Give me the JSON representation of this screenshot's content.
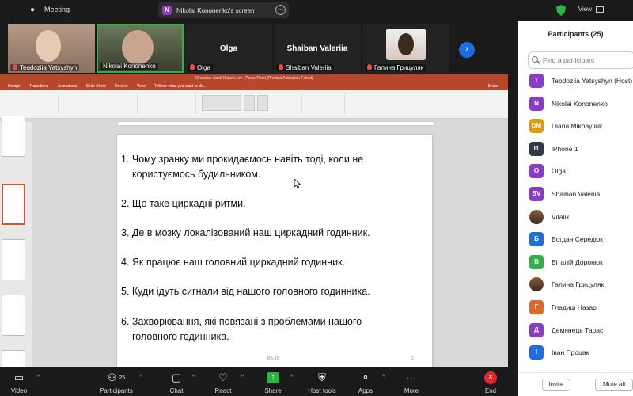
{
  "topbar": {
    "app_title": "Meeting",
    "share_badge": "N",
    "share_label": "Nikolai Kononenko's screen",
    "more": "···",
    "view_label": "View"
  },
  "video_tiles": [
    {
      "name": "Teodoziia Yatsyshyn",
      "muted": true
    },
    {
      "name": "Nikolai Kononenko",
      "muted": false
    },
    {
      "big_name": "Olga",
      "name": "Olga",
      "muted": true
    },
    {
      "big_name": "Shaiban Valeriia",
      "name": "Shaiban Valeriia",
      "muted": true
    },
    {
      "name": "Галина Грицуляк",
      "muted": true
    }
  ],
  "powerpoint": {
    "title": "Circadian clock Report.1cv - PowerPoint (Product Activation Failed)",
    "tabs": [
      "Design",
      "Transitions",
      "Animations",
      "Slide Show",
      "Review",
      "View",
      "Tell me what you want to do..."
    ],
    "share": "Share",
    "slide_lines": [
      "1. Чому зранку ми прокидаємось навіть тоді, коли не",
      "користуємось будильником.",
      "2. Що таке циркадні ритми.",
      "3. Де в мозку локалізований наш циркадний годинник.",
      "4. Як працює наш головний циркадний годинник.",
      "5. Куди ідуть сигнали від нашого головного годинника.",
      "6. Захворювання, які повязані з проблемами нашого",
      "головного годинника."
    ],
    "footer": "ИБ-33",
    "slide_number": "2"
  },
  "toolbar": {
    "video": "Video",
    "participants": "Participants",
    "participants_count": "25",
    "chat": "Chat",
    "react": "React",
    "share": "Share",
    "host_tools": "Host tools",
    "apps": "Apps",
    "more": "More",
    "end": "End"
  },
  "panel": {
    "title": "Participants (25)",
    "search_placeholder": "Find a participant",
    "invite": "Invite",
    "mute_all": "Mute all",
    "participants": [
      {
        "initials": "T",
        "name": "Teodoziia Yatsyshyn (Host)",
        "color": "#8a3cc9"
      },
      {
        "initials": "N",
        "name": "Nikolai Kononenko",
        "color": "#8a3cc9"
      },
      {
        "initials": "DM",
        "name": "Diana Mikhayliuk",
        "color": "#e39a0c"
      },
      {
        "initials": "I1",
        "name": "iPhone 1",
        "color": "#2f3b4a"
      },
      {
        "initials": "O",
        "name": "Olga",
        "color": "#8a3cc9"
      },
      {
        "initials": "SV",
        "name": "Shaiban Valeriia",
        "color": "#8a3cc9"
      },
      {
        "initials": "",
        "name": "Vitalik",
        "color": "photo"
      },
      {
        "initials": "Б",
        "name": "Богдан Середюк",
        "color": "#1d6fe0"
      },
      {
        "initials": "В",
        "name": "Віталій Доронюк",
        "color": "#2fb344"
      },
      {
        "initials": "",
        "name": "Галина Грицуляк",
        "color": "photo"
      },
      {
        "initials": "Г",
        "name": "Гладиш Назар",
        "color": "#e0682a"
      },
      {
        "initials": "Д",
        "name": "Демянець Тарас",
        "color": "#8a3cc9"
      },
      {
        "initials": "І",
        "name": "Іван Процак",
        "color": "#1d6fe0"
      }
    ]
  }
}
